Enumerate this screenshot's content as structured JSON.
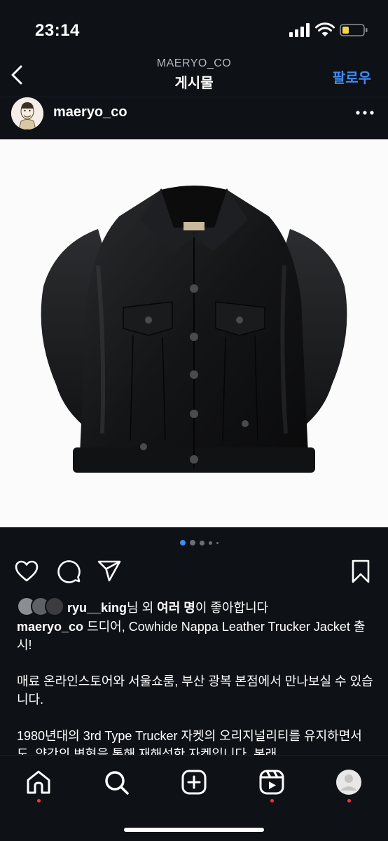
{
  "status": {
    "time": "23:14"
  },
  "nav": {
    "account": "MAERYO_CO",
    "title": "게시물",
    "follow_label": "팔로우"
  },
  "post": {
    "username": "maeryo_co",
    "carousel": {
      "total": 5,
      "active": 1
    },
    "likes": {
      "liker": "ryu__king",
      "middle": "님 외 ",
      "others": "여러 명",
      "suffix": "이 좋아합니다"
    },
    "caption": {
      "author": "maeryo_co",
      "line1": " 드디어, Cowhide Nappa Leather Trucker Jacket 출시!",
      "para2": "매료 온라인스토어와 서울쇼룸, 부산 광복 본점에서 만나보실 수 있습니다.",
      "para3": "1980년대의 3rd Type Trucker 자켓의 오리지널리티를 유지하면서도, 약간의 변형을 통해 재해석한 자켓입니다. 본래"
    }
  },
  "colors": {
    "background": "#0e1116",
    "accent": "#3f8cf3",
    "notification": "#ff3040"
  },
  "icons": {
    "tabs": [
      "home-icon",
      "search-icon",
      "create-icon",
      "reels-icon",
      "profile-icon"
    ],
    "actions": [
      "heart-icon",
      "comment-icon",
      "share-icon",
      "bookmark-icon"
    ]
  }
}
